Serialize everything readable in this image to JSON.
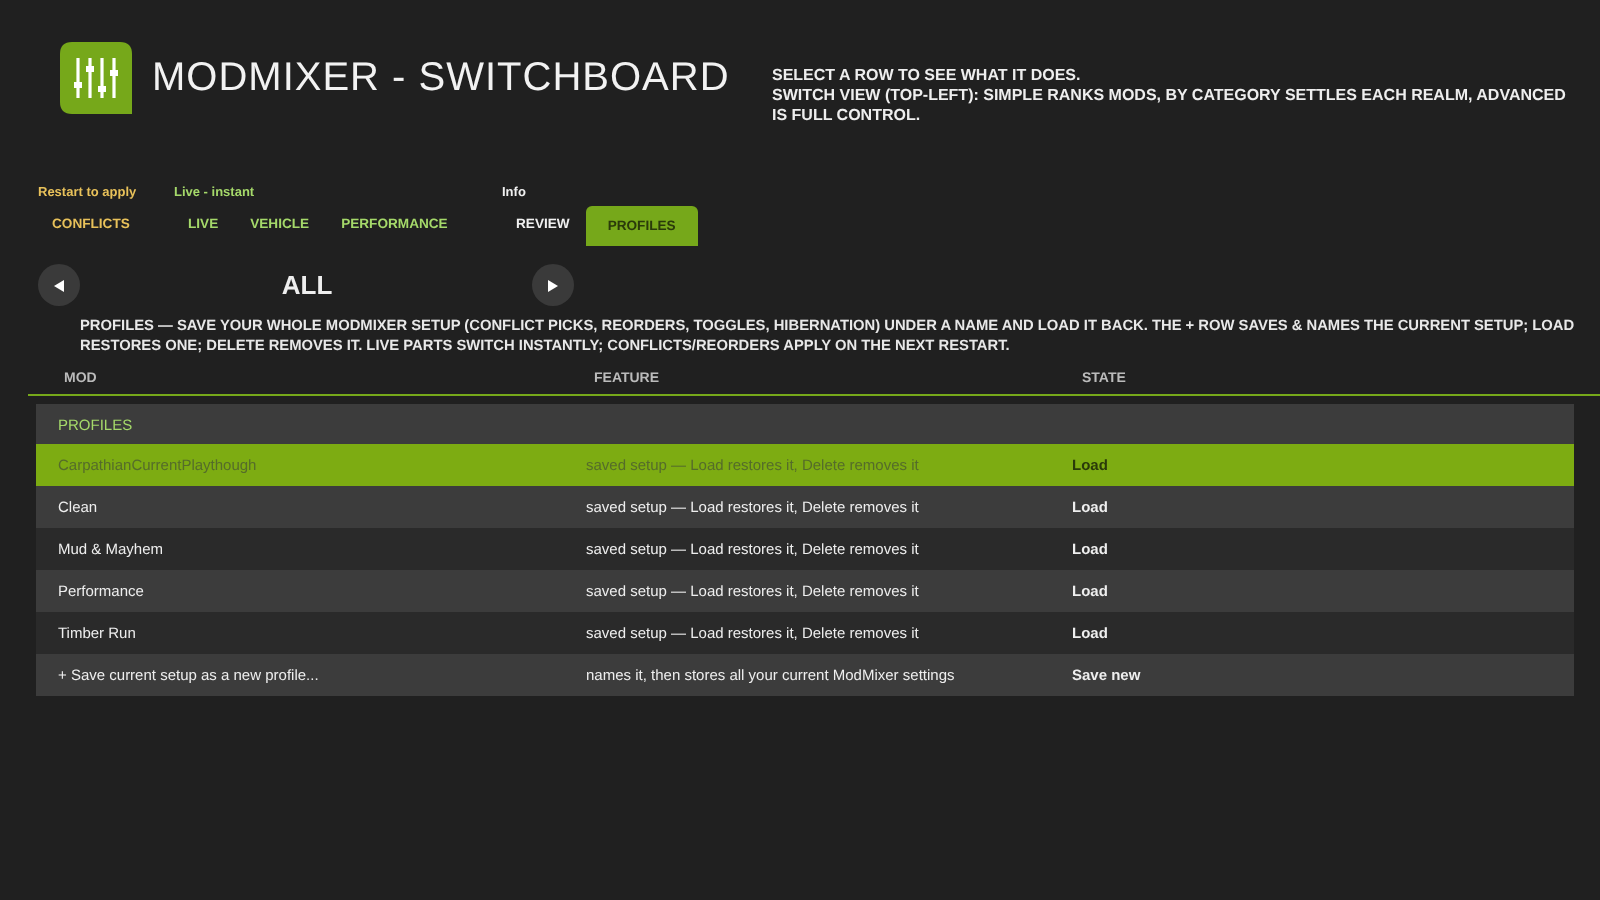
{
  "header": {
    "title": "MODMIXER - SWITCHBOARD",
    "help_lines": [
      "SELECT A ROW TO SEE WHAT IT DOES.",
      "SWITCH VIEW (TOP-LEFT): SIMPLE RANKS MODS, BY CATEGORY SETTLES EACH REALM, ADVANCED IS FULL CONTROL."
    ]
  },
  "tab_groups": [
    {
      "label": "Restart to apply",
      "color": "#e8c15a",
      "tabs": [
        {
          "label": "CONFLICTS",
          "selected": false
        }
      ]
    },
    {
      "label": "Live - instant",
      "color": "#a5d96a",
      "tabs": [
        {
          "label": "LIVE",
          "selected": false
        },
        {
          "label": "VEHICLE",
          "selected": false
        },
        {
          "label": "PERFORMANCE",
          "selected": false
        }
      ]
    },
    {
      "label": "Info",
      "color": "#f0f0f0",
      "tabs": [
        {
          "label": "REVIEW",
          "selected": false
        },
        {
          "label": "PROFILES",
          "selected": true
        }
      ]
    }
  ],
  "category": {
    "label": "ALL"
  },
  "description": "PROFILES — SAVE YOUR WHOLE MODMIXER SETUP (CONFLICT PICKS, REORDERS, TOGGLES, HIBERNATION) UNDER A NAME AND LOAD IT BACK. THE + ROW SAVES & NAMES THE CURRENT SETUP; LOAD RESTORES ONE; DELETE REMOVES IT. LIVE PARTS SWITCH INSTANTLY; CONFLICTS/REORDERS APPLY ON THE NEXT RESTART.",
  "table": {
    "columns": [
      "MOD",
      "FEATURE",
      "STATE"
    ],
    "section": "PROFILES",
    "rows": [
      {
        "mod": "CarpathianCurrentPlaythough",
        "feature": "saved setup — Load restores it, Delete removes it",
        "state": "Load",
        "selected": true
      },
      {
        "mod": "Clean",
        "feature": "saved setup — Load restores it, Delete removes it",
        "state": "Load",
        "selected": false
      },
      {
        "mod": "Mud & Mayhem",
        "feature": "saved setup — Load restores it, Delete removes it",
        "state": "Load",
        "selected": false
      },
      {
        "mod": "Performance",
        "feature": "saved setup — Load restores it, Delete removes it",
        "state": "Load",
        "selected": false
      },
      {
        "mod": "Timber Run",
        "feature": "saved setup — Load restores it, Delete removes it",
        "state": "Load",
        "selected": false
      },
      {
        "mod": "+ Save current setup as a new profile...",
        "feature": "names it, then stores all your current ModMixer settings",
        "state": "Save new",
        "selected": false
      }
    ]
  }
}
